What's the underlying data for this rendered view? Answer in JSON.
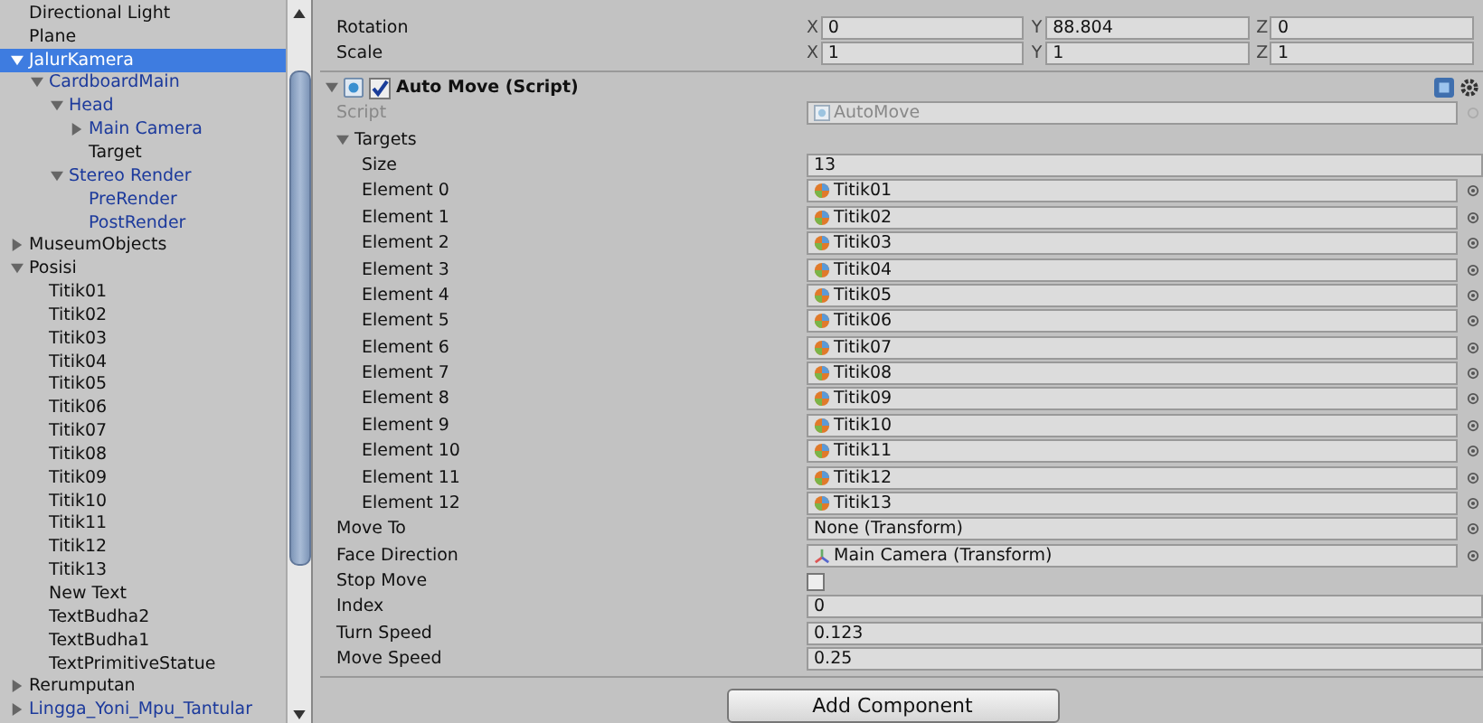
{
  "hierarchy": {
    "items": [
      {
        "label": "Directional Light",
        "kind": "leaf",
        "prefab": false,
        "selected": false
      },
      {
        "label": "Plane",
        "kind": "leaf",
        "prefab": false,
        "selected": false
      },
      {
        "label": "JalurKamera",
        "kind": "group",
        "expanded": true,
        "prefab": true,
        "selected": true,
        "children": [
          {
            "label": "CardboardMain",
            "kind": "group",
            "expanded": true,
            "prefab": true,
            "selected": false,
            "children": [
              {
                "label": "Head",
                "kind": "group",
                "expanded": true,
                "prefab": true,
                "selected": false,
                "children": [
                  {
                    "label": "Main Camera",
                    "kind": "group",
                    "expanded": false,
                    "prefab": true,
                    "selected": false
                  },
                  {
                    "label": "Target",
                    "kind": "leaf",
                    "prefab": false,
                    "selected": false
                  }
                ]
              },
              {
                "label": "Stereo Render",
                "kind": "group",
                "expanded": true,
                "prefab": true,
                "selected": false,
                "children": [
                  {
                    "label": "PreRender",
                    "kind": "leaf",
                    "prefab": true,
                    "selected": false
                  },
                  {
                    "label": "PostRender",
                    "kind": "leaf",
                    "prefab": true,
                    "selected": false
                  }
                ]
              }
            ]
          }
        ]
      },
      {
        "label": "MuseumObjects",
        "kind": "group",
        "expanded": false,
        "prefab": false,
        "selected": false
      },
      {
        "label": "Posisi",
        "kind": "group",
        "expanded": true,
        "prefab": false,
        "selected": false,
        "children": [
          {
            "label": "Titik01",
            "kind": "leaf",
            "prefab": false,
            "selected": false
          },
          {
            "label": "Titik02",
            "kind": "leaf",
            "prefab": false,
            "selected": false
          },
          {
            "label": "Titik03",
            "kind": "leaf",
            "prefab": false,
            "selected": false
          },
          {
            "label": "Titik04",
            "kind": "leaf",
            "prefab": false,
            "selected": false
          },
          {
            "label": "Titik05",
            "kind": "leaf",
            "prefab": false,
            "selected": false
          },
          {
            "label": "Titik06",
            "kind": "leaf",
            "prefab": false,
            "selected": false
          },
          {
            "label": "Titik07",
            "kind": "leaf",
            "prefab": false,
            "selected": false
          },
          {
            "label": "Titik08",
            "kind": "leaf",
            "prefab": false,
            "selected": false
          },
          {
            "label": "Titik09",
            "kind": "leaf",
            "prefab": false,
            "selected": false
          },
          {
            "label": "Titik10",
            "kind": "leaf",
            "prefab": false,
            "selected": false
          },
          {
            "label": "Titik11",
            "kind": "leaf",
            "prefab": false,
            "selected": false
          },
          {
            "label": "Titik12",
            "kind": "leaf",
            "prefab": false,
            "selected": false
          },
          {
            "label": "Titik13",
            "kind": "leaf",
            "prefab": false,
            "selected": false
          },
          {
            "label": "New Text",
            "kind": "leaf",
            "prefab": false,
            "selected": false
          },
          {
            "label": "TextBudha2",
            "kind": "leaf",
            "prefab": false,
            "selected": false
          },
          {
            "label": "TextBudha1",
            "kind": "leaf",
            "prefab": false,
            "selected": false
          },
          {
            "label": "TextPrimitiveStatue",
            "kind": "leaf",
            "prefab": false,
            "selected": false
          }
        ]
      },
      {
        "label": "Rerumputan",
        "kind": "group",
        "expanded": false,
        "prefab": false,
        "selected": false
      },
      {
        "label": "Lingga_Yoni_Mpu_Tantular",
        "kind": "group",
        "expanded": false,
        "prefab": true,
        "selected": false
      }
    ]
  },
  "transform_rows": [
    {
      "label": "Rotation",
      "x": {
        "axis": "X",
        "value": "0"
      },
      "y": {
        "axis": "Y",
        "value": "88.804"
      },
      "z": {
        "axis": "Z",
        "value": "0"
      }
    },
    {
      "label": "Scale",
      "x": {
        "axis": "X",
        "value": "1"
      },
      "y": {
        "axis": "Y",
        "value": "1"
      },
      "z": {
        "axis": "Z",
        "value": "1"
      }
    }
  ],
  "component": {
    "title": "Auto Move (Script)",
    "expanded": true,
    "enabled": true,
    "properties": [
      {
        "kind": "script",
        "label": "Script",
        "value": "AutoMove",
        "disabled": true
      },
      {
        "kind": "array",
        "label": "Targets",
        "expanded": true,
        "size_label": "Size",
        "size": "13",
        "elements": [
          {
            "label": "Element 0",
            "value": "Titik01"
          },
          {
            "label": "Element 1",
            "value": "Titik02"
          },
          {
            "label": "Element 2",
            "value": "Titik03"
          },
          {
            "label": "Element 3",
            "value": "Titik04"
          },
          {
            "label": "Element 4",
            "value": "Titik05"
          },
          {
            "label": "Element 5",
            "value": "Titik06"
          },
          {
            "label": "Element 6",
            "value": "Titik07"
          },
          {
            "label": "Element 7",
            "value": "Titik08"
          },
          {
            "label": "Element 8",
            "value": "Titik09"
          },
          {
            "label": "Element 9",
            "value": "Titik10"
          },
          {
            "label": "Element 10",
            "value": "Titik11"
          },
          {
            "label": "Element 11",
            "value": "Titik12"
          },
          {
            "label": "Element 12",
            "value": "Titik13"
          }
        ]
      },
      {
        "kind": "object",
        "label": "Move To",
        "value": "None (Transform)"
      },
      {
        "kind": "transform",
        "label": "Face Direction",
        "value": "Main Camera (Transform)"
      },
      {
        "kind": "toggle",
        "label": "Stop Move",
        "checked": false
      },
      {
        "kind": "text",
        "label": "Index",
        "value": "0"
      },
      {
        "kind": "text",
        "label": "Turn Speed",
        "value": "0.123"
      },
      {
        "kind": "text",
        "label": "Move Speed",
        "value": "0.25"
      }
    ]
  },
  "add_button": "Add Component"
}
